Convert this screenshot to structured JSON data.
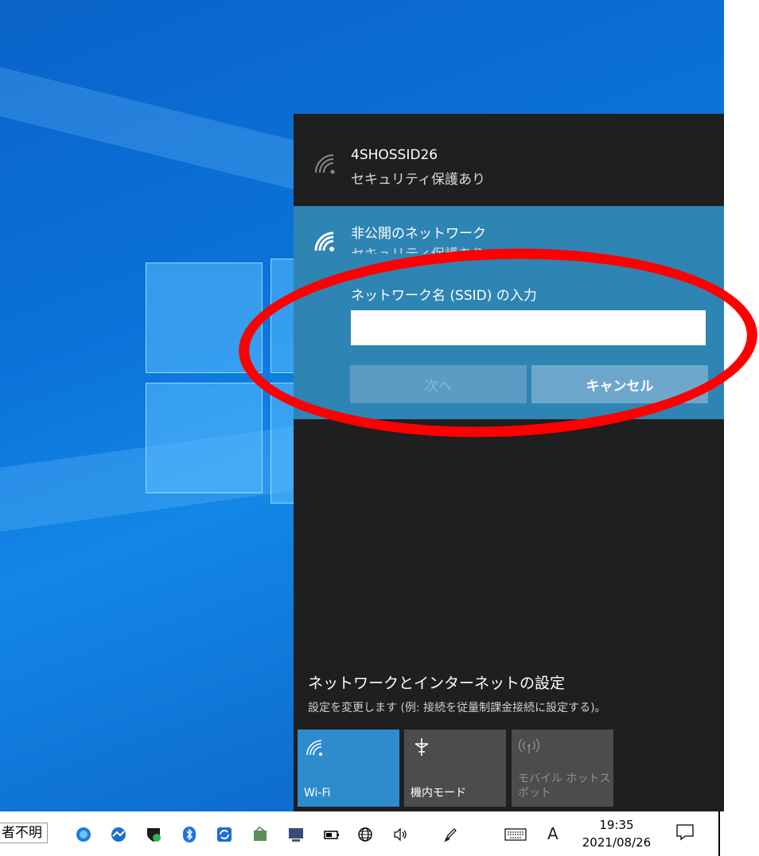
{
  "networks": [
    {
      "name": "4SHOSSID26",
      "status": "セキュリティ保護あり"
    }
  ],
  "hidden_network": {
    "name": "非公開のネットワーク",
    "status": "セキュリティ保護あり",
    "ssid_label": "ネットワーク名 (SSID) の入力",
    "ssid_value": "",
    "next_label": "次へ",
    "cancel_label": "キャンセル"
  },
  "settings": {
    "title": "ネットワークとインターネットの設定",
    "description": "設定を変更します (例: 接続を従量制課金接続に設定する)。"
  },
  "quick_actions": [
    {
      "label": "Wi-Fi",
      "icon": "wifi-icon",
      "active": true
    },
    {
      "label": "機内モード",
      "icon": "airplane-icon",
      "active": false
    },
    {
      "label": "モバイル ホットスポット",
      "icon": "hotspot-icon",
      "active": false,
      "disabled": true
    }
  ],
  "taskbar": {
    "truncated_text": "者不明",
    "ime_mode": "A",
    "time": "19:35",
    "date": "2021/08/26"
  },
  "colors": {
    "flyout_bg": "#1f1f1f",
    "panel_accent": "#2e84b3",
    "tile_active": "#2e8ccc",
    "highlight_circle": "#ff0000"
  }
}
